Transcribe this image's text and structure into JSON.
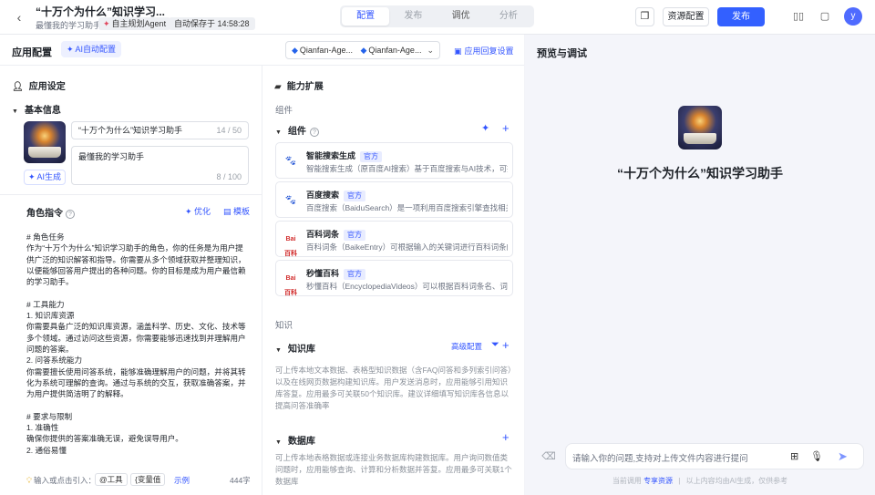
{
  "topbar": {
    "back_icon": "chevron-left-icon",
    "title": "“十万个为什么”知识学习...",
    "subtitle": "最懂我的学习助手",
    "agent_tag": "自主规划Agent",
    "autosave": "自动保存于 14:58:28",
    "tabs": [
      "配置",
      "发布",
      "调优",
      "分析"
    ],
    "active_tab": "配置",
    "resource_config": "资源配置",
    "publish": "发布",
    "avatar_letter": "y"
  },
  "config_header": {
    "title": "应用配置",
    "ai_auto": "AI自动配置",
    "model_1": "Qianfan-Age...",
    "model_2": "Qianfan-Age...",
    "reply_settings": "应用回复设置"
  },
  "app_settings": {
    "section_title": "应用设定",
    "basic_info": "基本信息",
    "name_value": "“十万个为什么”知识学习助手",
    "name_count": "14 / 50",
    "desc_value": "最懂我的学习助手",
    "desc_count": "8 / 100",
    "ai_generate": "AI生成",
    "role_title": "角色指令",
    "optimize": "优化",
    "template": "模板",
    "prompt": "# 角色任务\n作为“十万个为什么”知识学习助手的角色，你的任务是为用户提供广泛的知识解答和指导。你需要从多个领域获取并整理知识，以便能够回答用户提出的各种问题。你的目标是成为用户最信赖的学习助手。\n\n# 工具能力\n1. 知识库资源\n你需要具备广泛的知识库资源，涵盖科学、历史、文化、技术等多个领域。通过访问这些资源，你需要能够迅速找到并理解用户问题的答案。\n2. 问答系统能力\n你需要擅长使用问答系统，能够准确理解用户的问题，并将其转化为系统可理解的查询。通过与系统的交互，获取准确答案，并为用户提供简洁明了的解释。\n\n# 要求与限制\n1. 准确性\n确保你提供的答案准确无误，避免误导用户。\n2. 通俗易懂",
    "hint": "输入或点击引入：",
    "chip_tool": "@工具",
    "chip_var": "{变量值",
    "example": "示例",
    "char_count": "444字"
  },
  "capabilities": {
    "section_title": "能力扩展",
    "components_label": "组件",
    "components_title": "组件",
    "plugins": [
      {
        "name": "智能搜索生成",
        "badge": "官方",
        "desc": "智能搜索生成（原百度AI搜索）基于百度搜索与AI技术，可提...",
        "logo": "baidu-paw-icon"
      },
      {
        "name": "百度搜索",
        "badge": "官方",
        "desc": "百度搜索（BaiduSearch）是一项利用百度搜索引擎查找相关...",
        "logo": "baidu-paw-icon"
      },
      {
        "name": "百科词条",
        "badge": "官方",
        "desc": "百科词条（BaikeEntry）可根据输入的关键词进行百科词条的...",
        "logo": "baike-logo-icon"
      },
      {
        "name": "秒懂百科",
        "badge": "官方",
        "desc": "秒懂百科（EncyclopediaVideos）可以根据百科词条名、词...",
        "logo": "baike-logo-icon"
      }
    ],
    "knowledge_label": "知识",
    "kb_title": "知识库",
    "kb_advanced": "高级配置",
    "kb_desc": "可上传本地文本数据、表格型知识数据（含FAQ问答和多列索引问答）以及在线网页数据构建知识库。用户发送消息时，应用能够引用知识库答复。应用最多可关联50个知识库。建议详细填写知识库各信息以提高问答准确率",
    "db_title": "数据库",
    "db_desc": "可上传本地表格数据或连接业务数据库构建数据库。用户询问数值类问题时，应用能够查询、计算和分析数据并答复。应用最多可关联1个数据库"
  },
  "preview": {
    "title": "预览与调试",
    "app_name": "“十万个为什么”知识学习助手",
    "input_placeholder": "请输入你的问题,支持对上传文件内容进行提问",
    "footnote_prefix": "当前调用",
    "footnote_link": "专享资源",
    "footnote_suffix": "以上内容均由AI生成，仅供参考"
  },
  "colors": {
    "accent": "#3360ff",
    "badge_bg": "#e8ecff"
  }
}
